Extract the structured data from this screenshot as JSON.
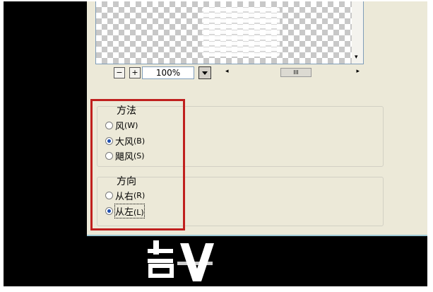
{
  "zoom": {
    "minus": "−",
    "plus": "+",
    "value": "100%"
  },
  "scroll": {
    "left_arrow": "◂",
    "right_arrow": "▸",
    "down_arrow": "▾",
    "thumb": "III"
  },
  "method": {
    "legend": "方法",
    "options": [
      {
        "label": "风",
        "key": "(W)",
        "checked": false
      },
      {
        "label": "大风",
        "key": "(B)",
        "checked": true
      },
      {
        "label": "飓风",
        "key": "(S)",
        "checked": false
      }
    ]
  },
  "direction": {
    "legend": "方向",
    "options": [
      {
        "label": "从右",
        "key": "(R)",
        "checked": false
      },
      {
        "label": "从左",
        "key": "(L)",
        "checked": true
      }
    ]
  },
  "colors": {
    "highlight": "#c0201e",
    "dialog_bg": "#ece9d8",
    "radio_dot": "#1f4fb0"
  }
}
